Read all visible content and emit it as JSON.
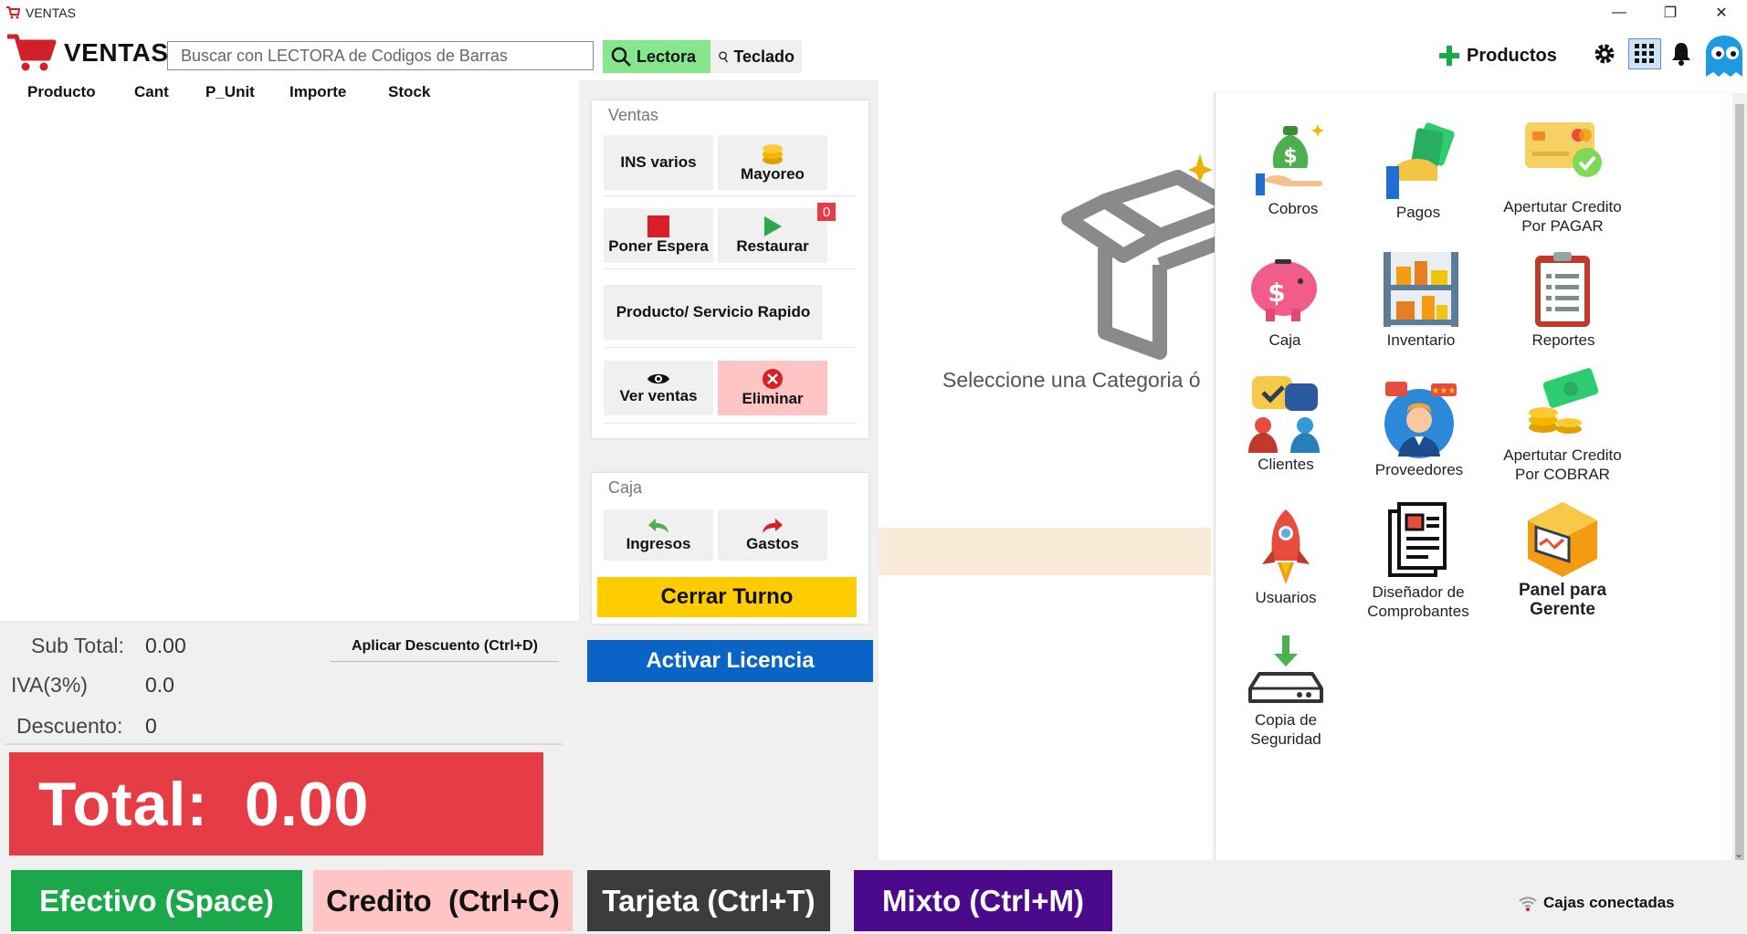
{
  "window": {
    "title": "VENTAS",
    "min": "—",
    "restore": "❐",
    "close": "✕"
  },
  "header": {
    "title": "VENTAS",
    "search_placeholder": "Buscar con LECTORA de Codigos de Barras",
    "lectora": "Lectora",
    "teclado": "Teclado",
    "productos": "Productos"
  },
  "table": {
    "columns": [
      "Producto",
      "Cant",
      "P_Unit",
      "Importe",
      "Stock"
    ]
  },
  "summary": {
    "subtotal_label": "Sub Total:",
    "subtotal_value": "0.00",
    "iva_label": "IVA(3%)",
    "iva_value": "0.0",
    "descuento_label": "Descuento:",
    "descuento_value": "0",
    "discount_button": "Aplicar Descuento (Ctrl+D)",
    "total_label": "Total:",
    "total_value": "0.00"
  },
  "ventas_panel": {
    "title": "Ventas",
    "ins_varios": "INS varios",
    "mayoreo": "Mayoreo",
    "poner_espera": "Poner Espera",
    "restaurar": "Restaurar",
    "restaurar_badge": "0",
    "producto_rapido": "Producto/ Servicio Rapido",
    "ver_ventas": "Ver ventas",
    "eliminar": "Eliminar"
  },
  "caja_panel": {
    "title": "Caja",
    "ingresos": "Ingresos",
    "gastos": "Gastos",
    "cerrar_turno": "Cerrar Turno"
  },
  "activar_licencia": "Activar Licencia",
  "category_message": "Seleccione una Categoria ó",
  "menu": {
    "cobros": "Cobros",
    "pagos": "Pagos",
    "credito_pagar_1": "Apertutar Credito",
    "credito_pagar_2": "Por PAGAR",
    "caja": "Caja",
    "inventario": "Inventario",
    "reportes": "Reportes",
    "clientes": "Clientes",
    "proveedores": "Proveedores",
    "credito_cobrar_1": "Apertutar Credito",
    "credito_cobrar_2": "Por COBRAR",
    "usuarios": "Usuarios",
    "disenador_1": "Diseñador de",
    "disenador_2": "Comprobantes",
    "panel_gerente_1": "Panel para",
    "panel_gerente_2": "Gerente",
    "copia_1": "Copia de",
    "copia_2": "Seguridad"
  },
  "footer": {
    "efectivo": "Efectivo (Space)",
    "credito": "Credito  (Ctrl+C)",
    "tarjeta": "Tarjeta (Ctrl+T)",
    "mixto": "Mixto (Ctrl+M)",
    "cajas_conectadas": "Cajas conectadas"
  },
  "colors": {
    "total_red": "#e63c45",
    "lectora_green": "#86e68c",
    "efectivo_green": "#1aa84a",
    "credito_pink": "#ffc4c4",
    "tarjeta_dark": "#3c3c3c",
    "mixto_purple": "#4b0a8c",
    "licencia_blue": "#0a64c8",
    "cerrar_yellow": "#ffcc00"
  }
}
